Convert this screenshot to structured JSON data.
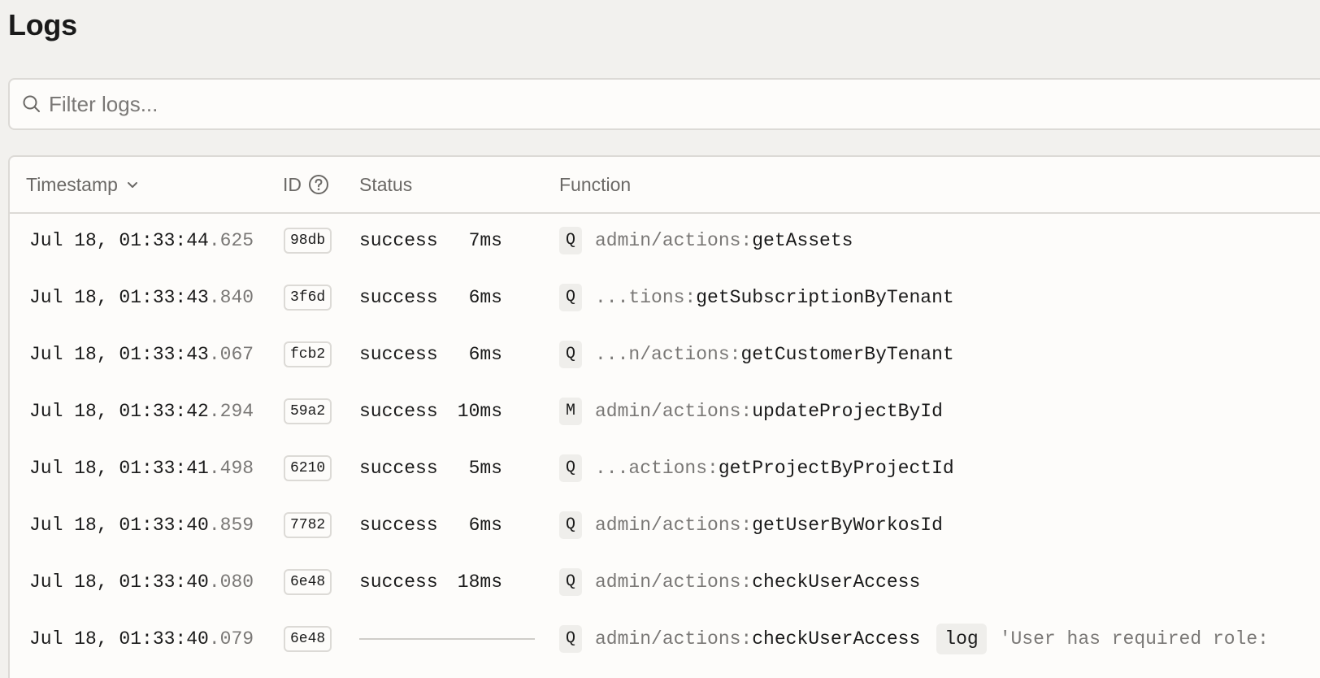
{
  "page": {
    "title": "Logs"
  },
  "search": {
    "placeholder": "Filter logs..."
  },
  "table": {
    "columns": {
      "timestamp": "Timestamp",
      "id": "ID",
      "status": "Status",
      "function": "Function"
    },
    "rows": [
      {
        "ts": "Jul 18, 01:33:44",
        "ms": ".625",
        "id": "98db",
        "status": "success",
        "duration": "7ms",
        "kind": "Q",
        "prefix": "admin/actions:",
        "fn": "getAssets"
      },
      {
        "ts": "Jul 18, 01:33:43",
        "ms": ".840",
        "id": "3f6d",
        "status": "success",
        "duration": "6ms",
        "kind": "Q",
        "prefix": "...tions:",
        "fn": "getSubscriptionByTenant"
      },
      {
        "ts": "Jul 18, 01:33:43",
        "ms": ".067",
        "id": "fcb2",
        "status": "success",
        "duration": "6ms",
        "kind": "Q",
        "prefix": "...n/actions:",
        "fn": "getCustomerByTenant"
      },
      {
        "ts": "Jul 18, 01:33:42",
        "ms": ".294",
        "id": "59a2",
        "status": "success",
        "duration": "10ms",
        "kind": "M",
        "prefix": "admin/actions:",
        "fn": "updateProjectById"
      },
      {
        "ts": "Jul 18, 01:33:41",
        "ms": ".498",
        "id": "6210",
        "status": "success",
        "duration": "5ms",
        "kind": "Q",
        "prefix": "...actions:",
        "fn": "getProjectByProjectId"
      },
      {
        "ts": "Jul 18, 01:33:40",
        "ms": ".859",
        "id": "7782",
        "status": "success",
        "duration": "6ms",
        "kind": "Q",
        "prefix": "admin/actions:",
        "fn": "getUserByWorkosId"
      },
      {
        "ts": "Jul 18, 01:33:40",
        "ms": ".080",
        "id": "6e48",
        "status": "success",
        "duration": "18ms",
        "kind": "Q",
        "prefix": "admin/actions:",
        "fn": "checkUserAccess"
      },
      {
        "ts": "Jul 18, 01:33:40",
        "ms": ".079",
        "id": "6e48",
        "kind": "Q",
        "prefix": "admin/actions:",
        "fn": "checkUserAccess",
        "log_level": "log",
        "log_message": "'User has required role:"
      }
    ]
  },
  "icons": {
    "search": "search-icon",
    "sort": "chevron-down-icon",
    "help": "help-circle-icon"
  },
  "colors": {
    "background": "#f2f1ee",
    "surface": "#fdfcfa",
    "border": "#dcdad6",
    "muted_text": "#7a7876",
    "badge_bg": "#efeeeb"
  }
}
